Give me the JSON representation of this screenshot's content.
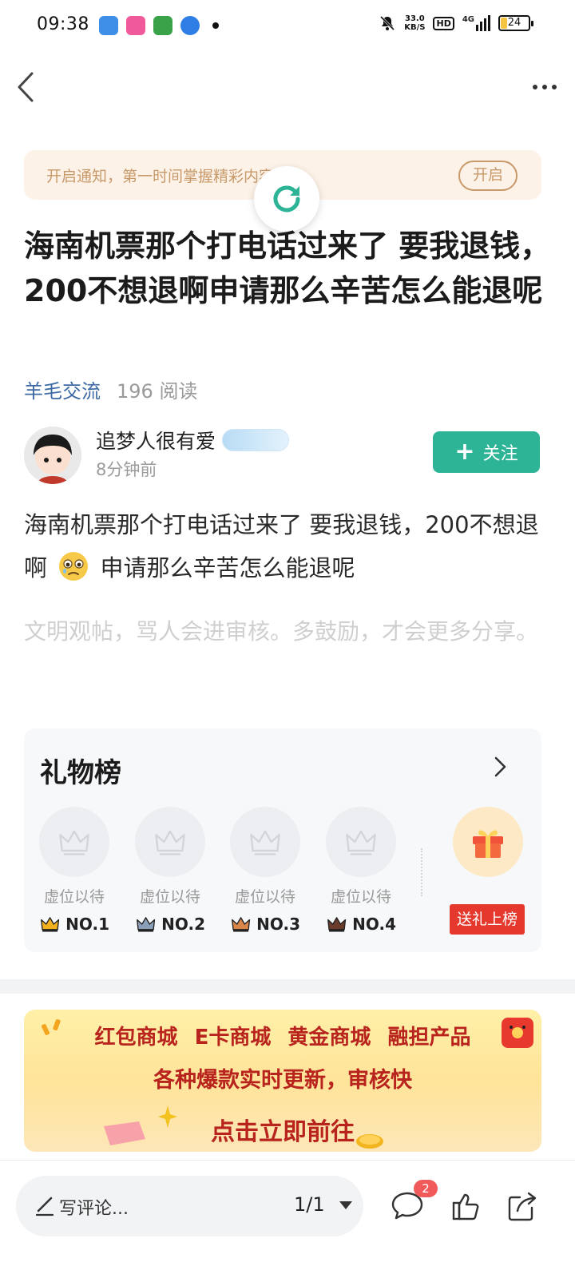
{
  "status_bar": {
    "time": "09:38",
    "net_speed_value": "33.0",
    "net_speed_unit": "KB/S",
    "hd_label": "HD",
    "signal_label": "4G",
    "battery": "24"
  },
  "nav": {
    "back_icon": "chevron-left-icon",
    "more_icon": "more-dots-icon"
  },
  "notice": {
    "text": "开启通知，第一时间掌握精彩内容!",
    "button": "开启"
  },
  "post": {
    "title": "海南机票那个打电话过来了 要我退钱，200不想退啊申请那么辛苦怎么能退呢",
    "category": "羊毛交流",
    "read_count": "196 阅读",
    "author_name": "追梦人很有爱",
    "time_ago": "8分钟前",
    "follow_label": "关注",
    "body_part1": "海南机票那个打电话过来了 要我退钱，200不想退啊",
    "body_part2": "申请那么辛苦怎么能退呢",
    "civil_note": "文明观帖，骂人会进审核。多鼓励，才会更多分享。"
  },
  "gift_board": {
    "title": "礼物榜",
    "slots": [
      {
        "label": "虚位以待",
        "rank": "NO.1",
        "crown_color": "#f2b01e"
      },
      {
        "label": "虚位以待",
        "rank": "NO.2",
        "crown_color": "#8aa0b8"
      },
      {
        "label": "虚位以待",
        "rank": "NO.3",
        "crown_color": "#d8864a"
      },
      {
        "label": "虚位以待",
        "rank": "NO.4",
        "crown_color": "#6b3b2c"
      }
    ],
    "send_button": "送礼上榜"
  },
  "promo": {
    "line1": "红包商城 E卡商城 黄金商城 融担产品",
    "line2": "各种爆款实时更新，审核快",
    "line3": "点击立即前往"
  },
  "bottom_bar": {
    "comment_placeholder": "写评论...",
    "page_indicator": "1/1",
    "comment_count": "2"
  },
  "colors": {
    "accent_green": "#2db395",
    "category_blue": "#3d6aa5",
    "notice_bg": "#fdf2e7",
    "promo_red": "#b8231e",
    "send_red": "#e5392d"
  }
}
